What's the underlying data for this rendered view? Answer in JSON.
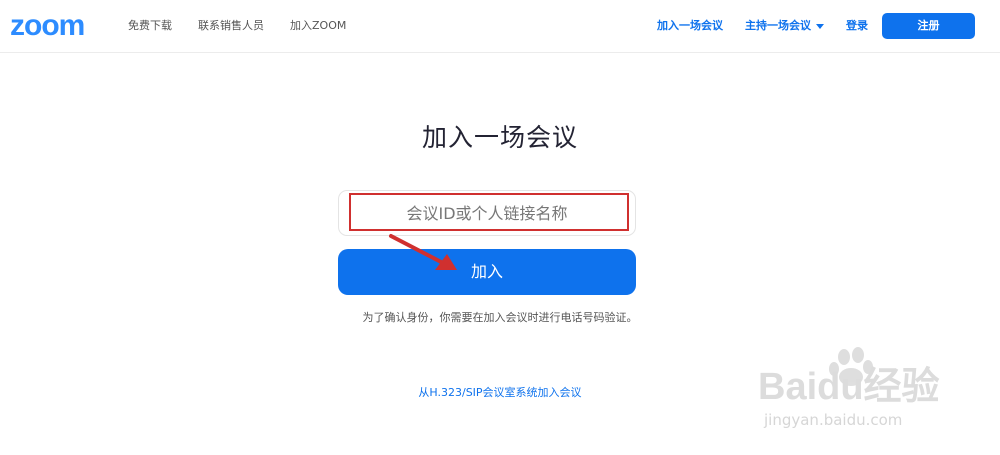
{
  "brand": {
    "logo_text": "zoom",
    "primary_color": "#0E72ED",
    "logo_color": "#2D8CFF"
  },
  "nav": {
    "left": [
      "免费下载",
      "联系销售人员",
      "加入ZOOM"
    ],
    "join_meeting": "加入一场会议",
    "host_meeting": "主持一场会议",
    "login": "登录",
    "signup": "注册"
  },
  "page": {
    "title": "加入一场会议",
    "input_placeholder": "会议ID或个人链接名称",
    "join_button": "加入",
    "notice": "为了确认身份，你需要在加入会议时进行电话号码验证。",
    "sip_link": "从H.323/SIP会议室系统加入会议"
  },
  "watermark": {
    "text_main": "Baidu经验",
    "text_sub": "jingyan.baidu.com"
  }
}
